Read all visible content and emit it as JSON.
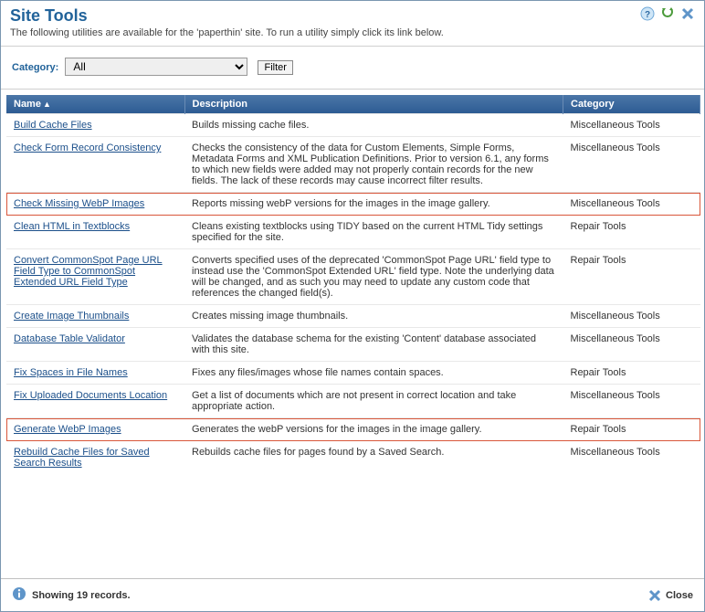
{
  "header": {
    "title": "Site Tools",
    "subtitle": "The following utilities are available for the 'paperthin' site. To run a utility simply click its link below."
  },
  "filter": {
    "label": "Category:",
    "selected": "All",
    "button": "Filter"
  },
  "columns": {
    "name": "Name",
    "description": "Description",
    "category": "Category"
  },
  "rows": [
    {
      "name": "Build Cache Files",
      "desc": "Builds missing cache files.",
      "cat": "Miscellaneous Tools",
      "hl": false
    },
    {
      "name": "Check Form Record Consistency",
      "desc": "Checks the consistency of the data for Custom Elements, Simple Forms, Metadata Forms and XML Publication Definitions. Prior to version 6.1, any forms to which new fields were added may not properly contain records for the new fields. The lack of these records may cause incorrect filter results.",
      "cat": "Miscellaneous Tools",
      "hl": false
    },
    {
      "name": "Check Missing WebP Images",
      "desc": "Reports missing webP versions for the images in the image gallery.",
      "cat": "Miscellaneous Tools",
      "hl": true
    },
    {
      "name": "Clean HTML in Textblocks",
      "desc": "Cleans existing textblocks using TIDY based on the current HTML Tidy settings specified for the site.",
      "cat": "Repair Tools",
      "hl": false
    },
    {
      "name": "Convert CommonSpot Page URL Field Type to CommonSpot Extended URL Field Type",
      "desc": "Converts specified uses of the deprecated 'CommonSpot Page URL' field type to instead use the 'CommonSpot Extended URL' field type. Note the underlying data will be changed, and as such you may need to update any custom code that references the changed field(s).",
      "cat": "Repair Tools",
      "hl": false
    },
    {
      "name": "Create Image Thumbnails",
      "desc": "Creates missing image thumbnails.",
      "cat": "Miscellaneous Tools",
      "hl": false
    },
    {
      "name": "Database Table Validator",
      "desc": "Validates the database schema for the existing 'Content' database associated with this site.",
      "cat": "Miscellaneous Tools",
      "hl": false
    },
    {
      "name": "Fix Spaces in File Names",
      "desc": "Fixes any files/images whose file names contain spaces.",
      "cat": "Repair Tools",
      "hl": false
    },
    {
      "name": "Fix Uploaded Documents Location",
      "desc": "Get a list of documents which are not present in correct location and take appropriate action.",
      "cat": "Miscellaneous Tools",
      "hl": false
    },
    {
      "name": "Generate WebP Images",
      "desc": "Generates the webP versions for the images in the image gallery.",
      "cat": "Repair Tools",
      "hl": true
    },
    {
      "name": "Rebuild Cache Files for Saved Search Results",
      "desc": "Rebuilds cache files for pages found by a Saved Search.",
      "cat": "Miscellaneous Tools",
      "hl": false
    }
  ],
  "footer": {
    "records": "Showing 19 records.",
    "close": "Close"
  }
}
